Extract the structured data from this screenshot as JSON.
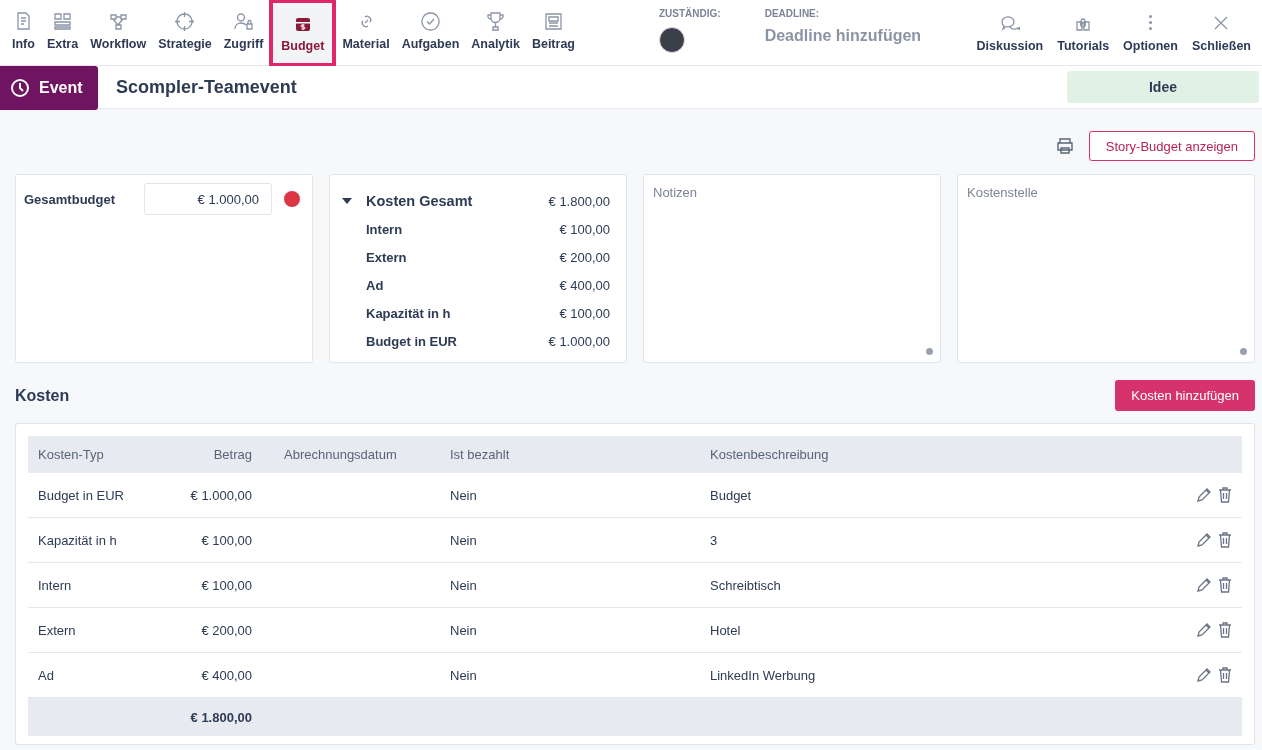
{
  "tabs": [
    {
      "label": "Info",
      "selected": false
    },
    {
      "label": "Extra",
      "selected": false
    },
    {
      "label": "Workflow",
      "selected": false
    },
    {
      "label": "Strategie",
      "selected": false
    },
    {
      "label": "Zugriff",
      "selected": false
    },
    {
      "label": "Budget",
      "selected": true
    },
    {
      "label": "Material",
      "selected": false
    },
    {
      "label": "Aufgaben",
      "selected": false
    },
    {
      "label": "Analytik",
      "selected": false
    },
    {
      "label": "Beitrag",
      "selected": false
    }
  ],
  "assignee": {
    "label": "ZUSTÄNDIG:"
  },
  "deadline": {
    "label": "DEADLINE:",
    "placeholder": "Deadline hinzufügen"
  },
  "actions": [
    {
      "label": "Diskussion"
    },
    {
      "label": "Tutorials"
    },
    {
      "label": "Optionen"
    },
    {
      "label": "Schließen"
    }
  ],
  "header": {
    "type": "Event",
    "title": "Scompler-Teamevent",
    "status": "Idee"
  },
  "story_budget_button": "Story-Budget anzeigen",
  "total_budget": {
    "label": "Gesamtbudget",
    "value": "€ 1.000,00",
    "color": "#dc3545"
  },
  "cost_summary": {
    "label": "Kosten Gesamt",
    "value": "€ 1.800,00",
    "expanded": true,
    "items": [
      {
        "label": "Intern",
        "value": "€ 100,00"
      },
      {
        "label": "Extern",
        "value": "€ 200,00"
      },
      {
        "label": "Ad",
        "value": "€ 400,00"
      },
      {
        "label": "Kapazität in h",
        "value": "€ 100,00"
      },
      {
        "label": "Budget in EUR",
        "value": "€ 1.000,00"
      }
    ]
  },
  "notes": {
    "placeholder": "Notizen"
  },
  "cost_center": {
    "placeholder": "Kostenstelle"
  },
  "costs": {
    "title": "Kosten",
    "add_button": "Kosten hinzufügen",
    "columns": [
      "Kosten-Typ",
      "Betrag",
      "Abrechnungsdatum",
      "Ist bezahlt",
      "Kostenbeschreibung"
    ],
    "rows": [
      [
        "Budget in EUR",
        "€ 1.000,00",
        "",
        "Nein",
        "Budget"
      ],
      [
        "Kapazität in h",
        "€ 100,00",
        "",
        "Nein",
        "3"
      ],
      [
        "Intern",
        "€ 100,00",
        "",
        "Nein",
        "Schreibtisch"
      ],
      [
        "Extern",
        "€ 200,00",
        "",
        "Nein",
        "Hotel"
      ],
      [
        "Ad",
        "€ 400,00",
        "",
        "Nein",
        "LinkedIn Werbung"
      ]
    ],
    "total": "€ 1.800,00"
  }
}
